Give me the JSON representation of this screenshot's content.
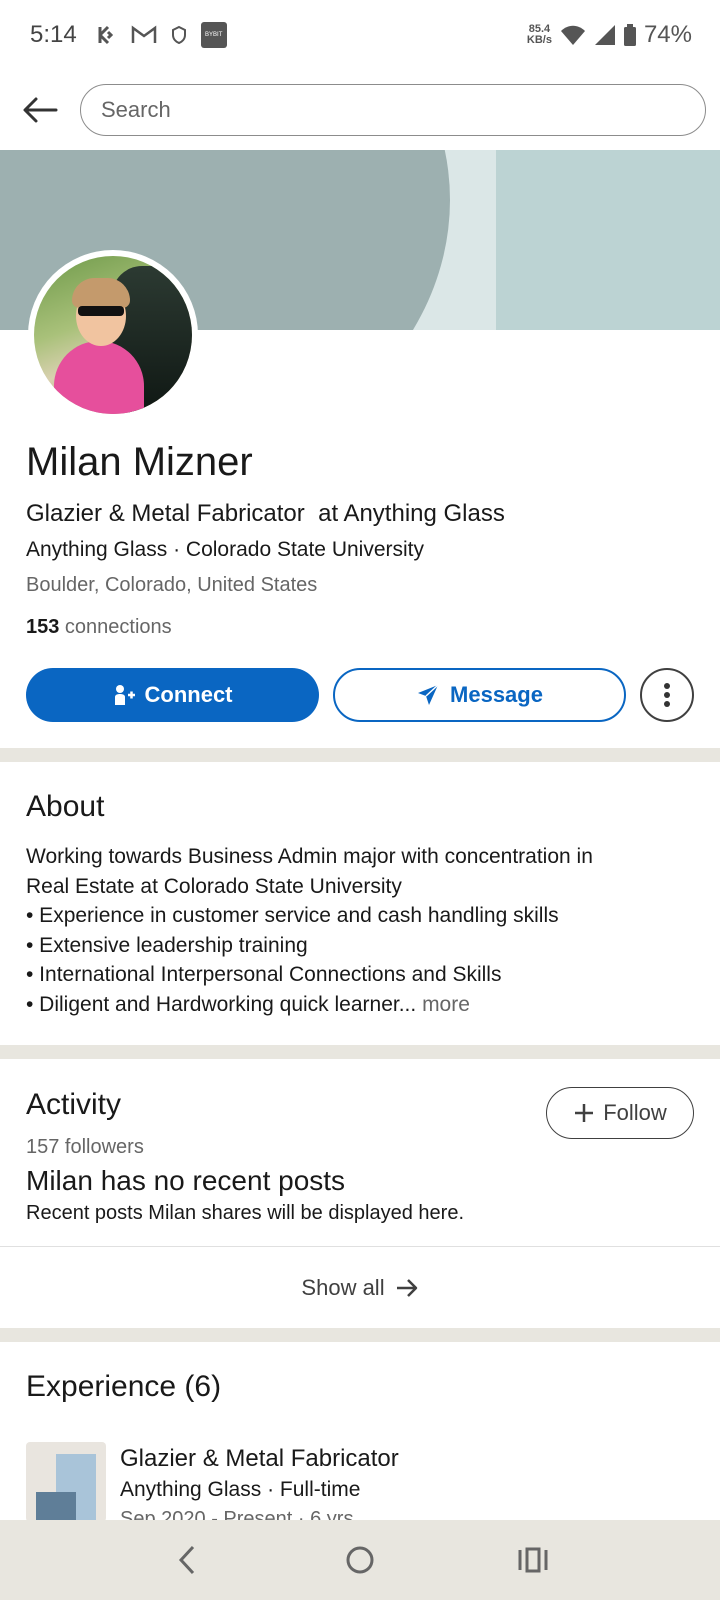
{
  "status_bar": {
    "time": "5:14",
    "net_speed_value": "85.4",
    "net_speed_unit": "KB/s",
    "battery": "74%",
    "bybit_label": "BYBIT"
  },
  "search": {
    "placeholder": "Search"
  },
  "profile": {
    "name": "Milan Mizner",
    "headline": "Glazier & Metal Fabricator  at Anything Glass",
    "subline": "Anything Glass · Colorado State University",
    "location": "Boulder, Colorado, United States",
    "connections_count": "153",
    "connections_label": " connections"
  },
  "actions": {
    "connect": "Connect",
    "message": "Message"
  },
  "about": {
    "title": "About",
    "lines": [
      "Working towards Business Admin major with concentration in",
      "Real Estate at Colorado State University",
      "• Experience in customer service and cash handling skills",
      "• Extensive leadership training",
      "• International Interpersonal Connections and Skills",
      "• Diligent and Hardworking quick learner..."
    ],
    "more": "more"
  },
  "activity": {
    "title": "Activity",
    "followers": "157 followers",
    "follow_button": "Follow",
    "no_posts_title": "Milan has no recent posts",
    "no_posts_sub": "Recent posts Milan shares will be displayed here.",
    "show_all": "Show all"
  },
  "experience": {
    "title": "Experience (6)",
    "items": [
      {
        "title": "Glazier & Metal Fabricator",
        "company": "Anything Glass · Full-time",
        "dates": "Sep 2020 - Present · 6 yrs"
      }
    ]
  },
  "colors": {
    "primary": "#0a66c2",
    "banner": "#bcd3d3",
    "divider": "#e8e6df"
  }
}
